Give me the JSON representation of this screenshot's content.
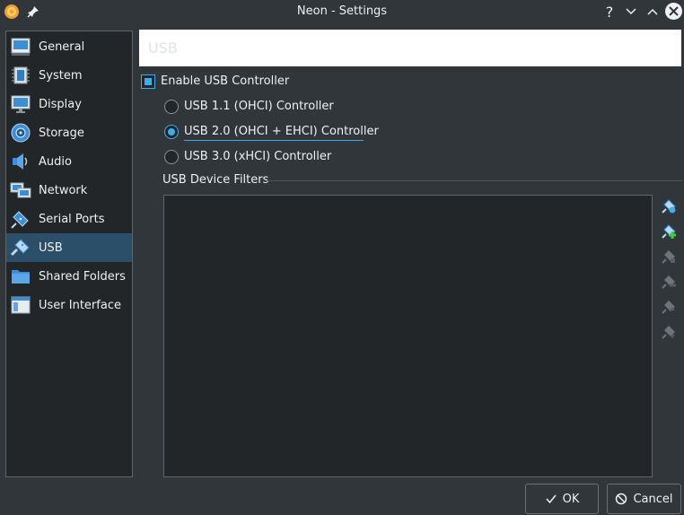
{
  "window": {
    "title": "Neon - Settings"
  },
  "titlebar": {
    "help_glyph": "?"
  },
  "sidebar": {
    "items": [
      {
        "label": "General",
        "icon": "general-icon",
        "selected": false
      },
      {
        "label": "System",
        "icon": "system-chip-icon",
        "selected": false
      },
      {
        "label": "Display",
        "icon": "display-monitor-icon",
        "selected": false
      },
      {
        "label": "Storage",
        "icon": "storage-disk-icon",
        "selected": false
      },
      {
        "label": "Audio",
        "icon": "audio-speaker-icon",
        "selected": false
      },
      {
        "label": "Network",
        "icon": "network-icon",
        "selected": false
      },
      {
        "label": "Serial Ports",
        "icon": "serial-port-icon",
        "selected": false
      },
      {
        "label": "USB",
        "icon": "usb-icon",
        "selected": true
      },
      {
        "label": "Shared Folders",
        "icon": "shared-folder-icon",
        "selected": false
      },
      {
        "label": "User Interface",
        "icon": "user-interface-icon",
        "selected": false
      }
    ]
  },
  "page": {
    "title": "USB",
    "enable_usb": {
      "label": "Enable USB Controller",
      "checked": true
    },
    "controllers": [
      {
        "label": "USB 1.1 (OHCI) Controller",
        "checked": false
      },
      {
        "label": "USB 2.0 (OHCI + EHCI) Controller",
        "checked": true
      },
      {
        "label": "USB 3.0 (xHCI) Controller",
        "checked": false
      }
    ],
    "filters": {
      "label": "USB Device Filters",
      "buttons": [
        {
          "icon": "add-empty-filter-icon",
          "enabled": true
        },
        {
          "icon": "add-filter-from-device-icon",
          "enabled": true
        },
        {
          "icon": "edit-filter-icon",
          "enabled": false
        },
        {
          "icon": "remove-filter-icon",
          "enabled": false
        },
        {
          "icon": "move-filter-up-icon",
          "enabled": false
        },
        {
          "icon": "move-filter-down-icon",
          "enabled": false
        }
      ]
    }
  },
  "buttons": {
    "ok": "OK",
    "cancel": "Cancel"
  },
  "colors": {
    "accent": "#3daee9",
    "window_bg": "#31363b",
    "panel_bg": "#232629",
    "selection": "#2b4f68"
  }
}
